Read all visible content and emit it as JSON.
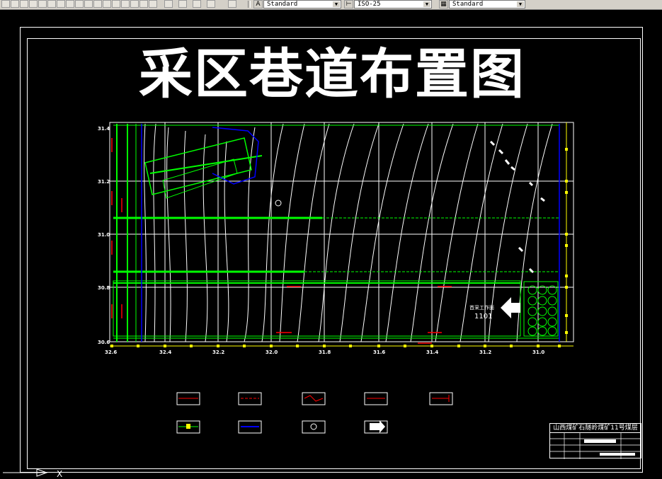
{
  "toolbar": {
    "text_style": "Standard",
    "dim_style": "ISO-25",
    "table_style": "Standard"
  },
  "drawing": {
    "title": "采区巷道布置图",
    "y_axis_labels": [
      "31.4",
      "31.2",
      "31.0",
      "30.8",
      "30.6"
    ],
    "x_axis_labels": [
      "32.6",
      "32.4",
      "32.2",
      "32.0",
      "31.8",
      "31.6",
      "31.4",
      "31.2",
      "31.0"
    ],
    "workface_label": "首采工作面",
    "workface_number": "1101",
    "titleblock_company": "山西煤矿石隧岭煤矿11号煤层"
  },
  "colors": {
    "background": "#000000",
    "grid": "#ffffff",
    "contour": "#ffffff",
    "roadway": "#00ff00",
    "boundary": "#ffff00",
    "fault": "#0000ff",
    "annotation": "#ff0000"
  },
  "legend": {
    "items": [
      {
        "icon": "red-line-symbol"
      },
      {
        "icon": "red-dash-symbol"
      },
      {
        "icon": "red-wave-symbol"
      },
      {
        "icon": "red-cross-symbol"
      },
      {
        "icon": "red-bracket-symbol"
      },
      {
        "icon": "yellow-dot-symbol"
      },
      {
        "icon": "blue-line-symbol"
      },
      {
        "icon": "borehole-symbol"
      },
      {
        "icon": "arrow-symbol"
      }
    ]
  }
}
